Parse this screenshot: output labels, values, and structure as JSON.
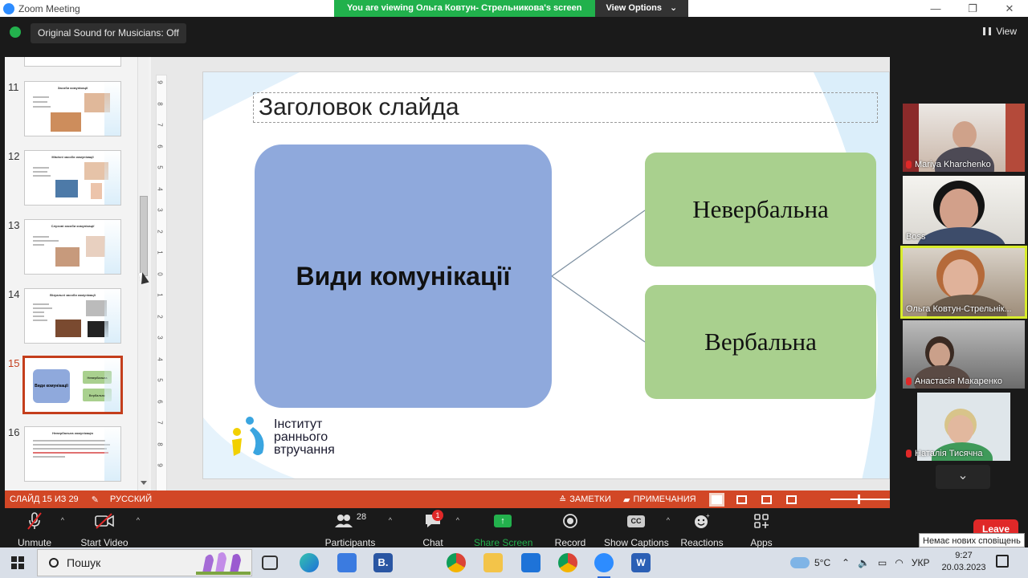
{
  "window": {
    "app_title": "Zoom Meeting",
    "viewing_banner": "You are viewing Ольга Ковтун- Стрельникова's screen",
    "view_options": "View Options",
    "original_sound": "Original Sound for Musicians: Off",
    "view_label": "View"
  },
  "slides_panel": {
    "thumbnails": [
      {
        "number": "11",
        "title": "Засоби комунікації",
        "bullets": [
          "Мимічні",
          "Слухові",
          "Тілесні"
        ]
      },
      {
        "number": "12",
        "title": "Мімічні засоби комунікації",
        "bullets": [
          "Емоції",
          "Міміка",
          "Вирази обличчя"
        ]
      },
      {
        "number": "13",
        "title": "Слухові засоби комунікації",
        "bullets": [
          "Вокалізації",
          "Звукові реакції",
          "Звуки"
        ]
      },
      {
        "number": "14",
        "title": "Візуальні засоби комунікації",
        "bullets": [
          "Предмети",
          "Фотографії",
          "Символи",
          "Жести",
          "Піктограми"
        ]
      },
      {
        "number": "15",
        "title": "Види комунікації",
        "selected": true
      },
      {
        "number": "16",
        "title": "Невербальна комунікація"
      }
    ]
  },
  "slide": {
    "title": "Заголовок слайда",
    "main_box": "Види комунікації",
    "box_top": "Невербальна",
    "box_bottom": "Вербальна",
    "logo_lines": [
      "Інститут",
      "раннього",
      "втручання"
    ]
  },
  "ruler_labels": [
    "9",
    "8",
    "7",
    "6",
    "5",
    "4",
    "3",
    "2",
    "1",
    "0",
    "1",
    "2",
    "3",
    "4",
    "5",
    "6",
    "7",
    "8",
    "9"
  ],
  "ppt_status": {
    "slide_counter": "СЛАЙД 15 ИЗ 29",
    "language": "РУССКИЙ",
    "notes": "ЗАМЕТКИ",
    "comments": "ПРИМЕЧАНИЯ"
  },
  "participants_gallery": [
    {
      "name": "Mariya Kharchenko",
      "muted": true
    },
    {
      "name": "Boss",
      "muted": false
    },
    {
      "name": "Ольга Ковтун-Стрельнік...",
      "muted": false,
      "active": true
    },
    {
      "name": "Анастасія Макаренко",
      "muted": true
    },
    {
      "name": "Наталія Тисячна",
      "muted": true
    }
  ],
  "toolbar": {
    "unmute": "Unmute",
    "start_video": "Start Video",
    "participants_count": "28",
    "participants": "Participants",
    "chat": "Chat",
    "chat_badge": "1",
    "share_screen": "Share Screen",
    "record": "Record",
    "show_captions": "Show Captions",
    "reactions": "Reactions",
    "apps": "Apps",
    "leave": "Leave",
    "toast": "Немає нових сповіщень"
  },
  "taskbar": {
    "search_placeholder": "Пошук",
    "temperature": "5°C",
    "language": "УКР",
    "time": "9:27",
    "date": "20.03.2023"
  },
  "colors": {
    "zoom_blue": "#2d8cff",
    "banner_green": "#21b14c",
    "ppt_orange": "#d24726",
    "main_box": "#8fa9dc",
    "side_box": "#a9d08e",
    "leave_red": "#e02828",
    "active_speaker": "#d8ec2b"
  },
  "icons": [
    "zoom-logo",
    "shield-icon",
    "grid-icon",
    "mic-off-icon",
    "video-off-icon",
    "participants-icon",
    "chat-icon",
    "share-icon",
    "record-icon",
    "captions-icon",
    "reactions-icon",
    "apps-icon",
    "windows-icon",
    "search-icon"
  ]
}
